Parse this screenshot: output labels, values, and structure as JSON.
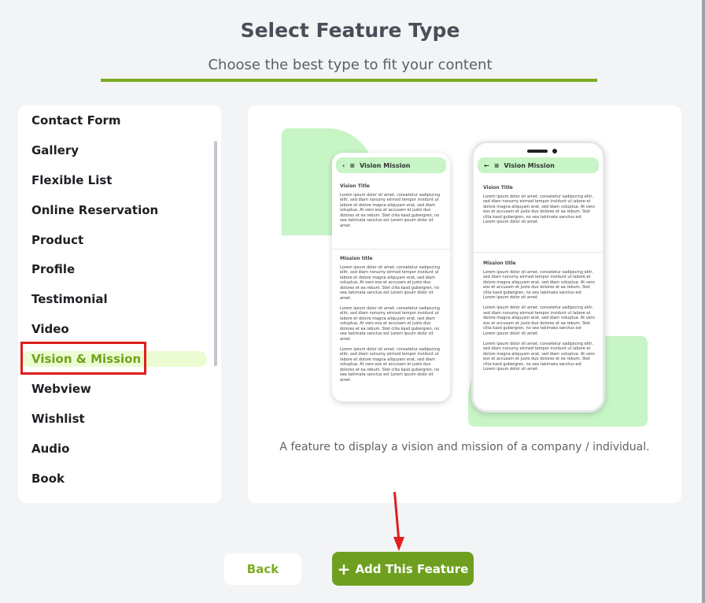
{
  "header": {
    "title": "Select Feature Type",
    "subtitle": "Choose the best type to fit your content"
  },
  "feature_list": {
    "items": [
      {
        "label": "Contact Form"
      },
      {
        "label": "Gallery"
      },
      {
        "label": "Flexible List"
      },
      {
        "label": "Online Reservation"
      },
      {
        "label": "Product"
      },
      {
        "label": "Profile"
      },
      {
        "label": "Testimonial"
      },
      {
        "label": "Video"
      },
      {
        "label": "Vision & Mission",
        "selected": true
      },
      {
        "label": "Webview"
      },
      {
        "label": "Wishlist"
      },
      {
        "label": "Audio"
      },
      {
        "label": "Book"
      }
    ]
  },
  "preview": {
    "phone_title": "Vision Mission",
    "vision_heading": "Vision Title",
    "mission_heading": "Mission title",
    "lorem": "Lorem ipsum dolor sit amet, consetetur sadipscing elitr, sed diam nonumy eirmod tempor invidunt ut labore et dolore magna aliquyam erat, sed diam voluptua. At vero eos et accusam et justo duo dolores et ea rebum. Stet clita kasd gubergren, no sea takimata sanctus est Lorem ipsum dolor sit amet.",
    "description": "A feature to display a vision and mission of a company / individual."
  },
  "actions": {
    "back_label": "Back",
    "add_label": "Add This Feature"
  },
  "colors": {
    "accent": "#7cab22",
    "selected_bg": "#ecfcd2",
    "annotation": "#e11d1d"
  }
}
